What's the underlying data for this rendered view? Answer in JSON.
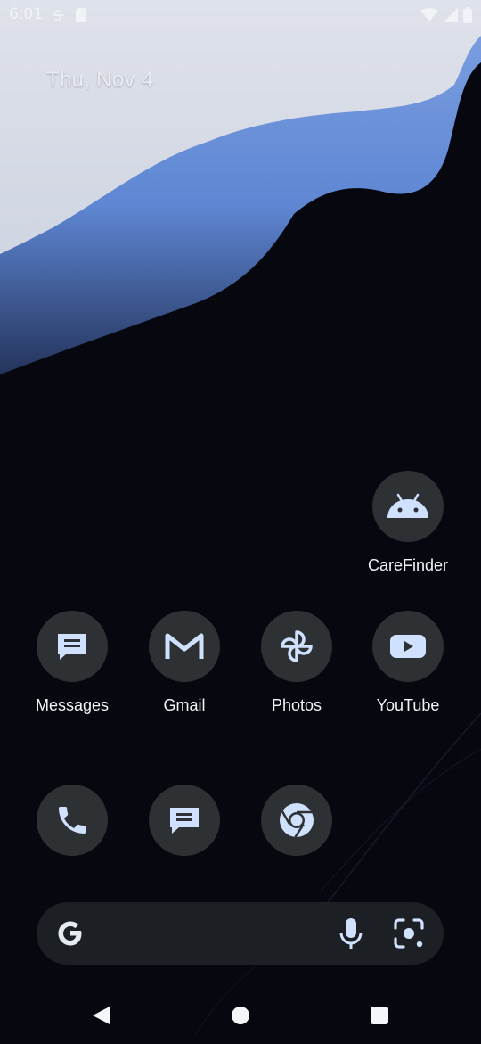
{
  "status_bar": {
    "time": "6:01",
    "left_icons": [
      "strikethrough-s-icon",
      "sd-card-icon"
    ],
    "right_icons": [
      "wifi-icon",
      "cell-signal-icon",
      "battery-icon"
    ]
  },
  "date_widget": {
    "text": "Thu, Nov 4"
  },
  "apps": [
    {
      "label": "CareFinder",
      "icon": "android-icon"
    },
    {
      "label": "Messages",
      "icon": "messages-icon"
    },
    {
      "label": "Gmail",
      "icon": "gmail-icon"
    },
    {
      "label": "Photos",
      "icon": "photos-icon"
    },
    {
      "label": "YouTube",
      "icon": "youtube-icon"
    }
  ],
  "dock": [
    {
      "icon": "phone-icon"
    },
    {
      "icon": "messages-icon"
    },
    {
      "icon": "chrome-icon"
    }
  ],
  "search_bar": {
    "icons": [
      "google-g-icon",
      "mic-icon",
      "lens-icon"
    ]
  },
  "nav_bar": {
    "icons": [
      "back-icon",
      "home-icon",
      "recents-icon"
    ]
  },
  "colors": {
    "icon_circle": "#2e3133",
    "icon_glyph": "#cfe1ff",
    "background": "#06070f",
    "wallpaper_light": "#d9dde7",
    "wallpaper_blue": "#6f93d8"
  }
}
